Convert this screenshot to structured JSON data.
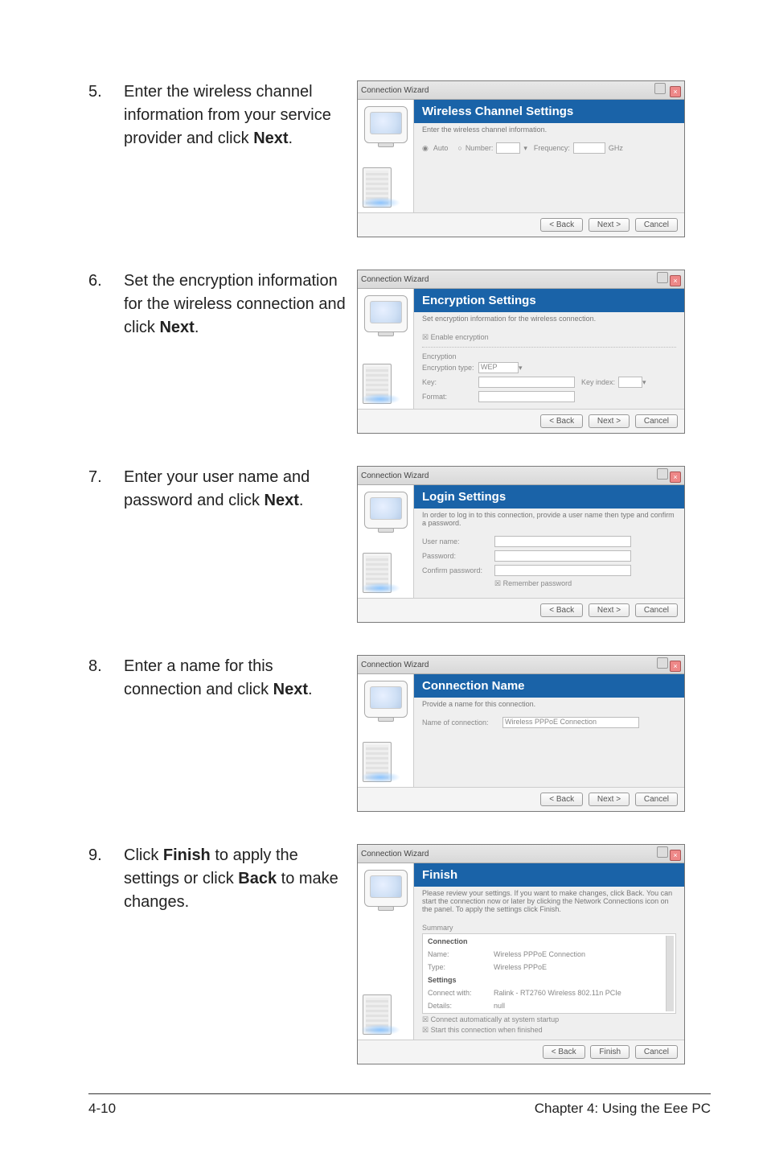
{
  "steps": [
    {
      "num": "5.",
      "parts": [
        "Enter the wireless channel information from your service provider and click ",
        "Next",
        "."
      ]
    },
    {
      "num": "6.",
      "parts": [
        "Set the encryption information for the wireless connection and click ",
        "Next",
        "."
      ]
    },
    {
      "num": "7.",
      "parts": [
        "Enter your user name and password and click ",
        "Next",
        "."
      ]
    },
    {
      "num": "8.",
      "parts": [
        "Enter a name for this connection and click ",
        "Next",
        "."
      ]
    },
    {
      "num": "9.",
      "parts": [
        "Click ",
        "Finish",
        " to apply the settings or click ",
        "Back",
        " to make changes."
      ]
    }
  ],
  "dialogs": {
    "common": {
      "title": "Connection Wizard",
      "back": "< Back",
      "next": "Next >",
      "cancel": "Cancel",
      "finish_btn": "Finish"
    },
    "d5": {
      "banner": "Wireless Channel Settings",
      "sub": "Enter the wireless channel information.",
      "auto": "Auto",
      "number_lbl": "Number:",
      "freq_lbl": "Frequency:",
      "ghz": "GHz"
    },
    "d6": {
      "banner": "Encryption Settings",
      "sub": "Set encryption information for the wireless connection.",
      "enable": "Enable encryption",
      "encryption": "Encryption",
      "enc_type": "Encryption type:",
      "enc_val": "WEP",
      "key_lbl": "Key:",
      "key_index": "Key index:",
      "format_lbl": "Format:"
    },
    "d7": {
      "banner": "Login Settings",
      "sub": "In order to log in to this connection, provide a user name then type and confirm a password.",
      "user": "User name:",
      "pass": "Password:",
      "confirm": "Confirm password:",
      "remember": "Remember password"
    },
    "d8": {
      "banner": "Connection Name",
      "sub": "Provide a name for this connection.",
      "name_lbl": "Name of connection:",
      "name_val": "Wireless PPPoE Connection"
    },
    "d9": {
      "banner": "Finish",
      "sub": "Please review your settings. If you want to make changes, click Back. You can start the connection now or later by clicking the Network Connections icon on the panel. To apply the settings click Finish.",
      "summary": "Summary",
      "connection_hdr": "Connection",
      "name_k": "Name:",
      "name_v": "Wireless PPPoE Connection",
      "type_k": "Type:",
      "type_v": "Wireless PPPoE",
      "settings_hdr": "Settings",
      "connect_with_k": "Connect with:",
      "connect_with_v": "Ralink - RT2760 Wireless 802.11n PCIe",
      "details_k": "Details:",
      "details_v": "null",
      "opt1": "Connect automatically at system startup",
      "opt2": "Start this connection when finished"
    }
  },
  "footer": {
    "left": "4-10",
    "right": "Chapter 4: Using the Eee PC"
  }
}
